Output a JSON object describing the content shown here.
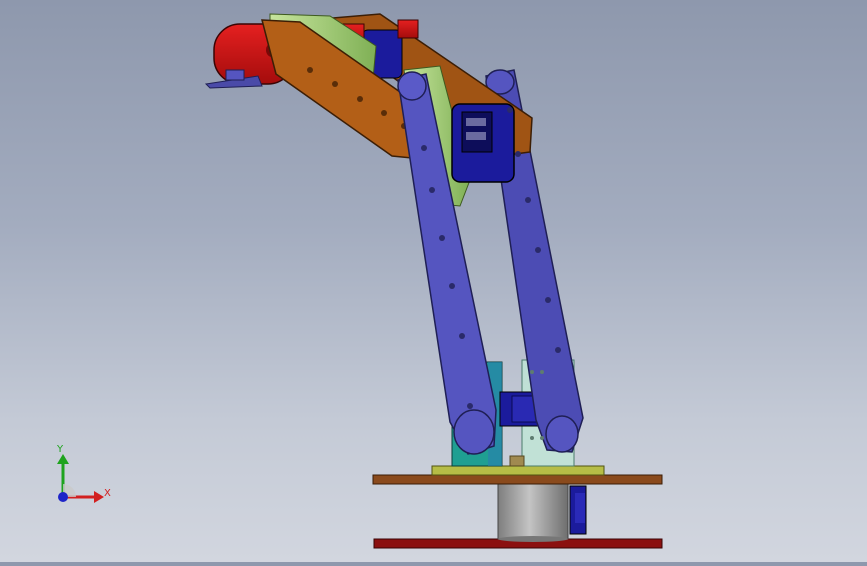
{
  "viewport": {
    "model": "robotic-arm-assembly",
    "colors": {
      "upper_arm": "#b35f17",
      "forearm_link": "#5555c0",
      "gripper_block": "#d41414",
      "servo": "#1b1b9c",
      "spacer_green": "#a9d57a",
      "base_plate": "#8a4a1c",
      "bottom_plate": "#8b1010",
      "shoulder_bracket": "#20a79a",
      "glass_bracket": "#b8e2d2",
      "motor": "#9a9a9a"
    }
  },
  "triad": {
    "x_label": "X",
    "y_label": "Y",
    "x_color": "#d22020",
    "y_color": "#1ea31e",
    "z_color": "#1d24c8"
  }
}
